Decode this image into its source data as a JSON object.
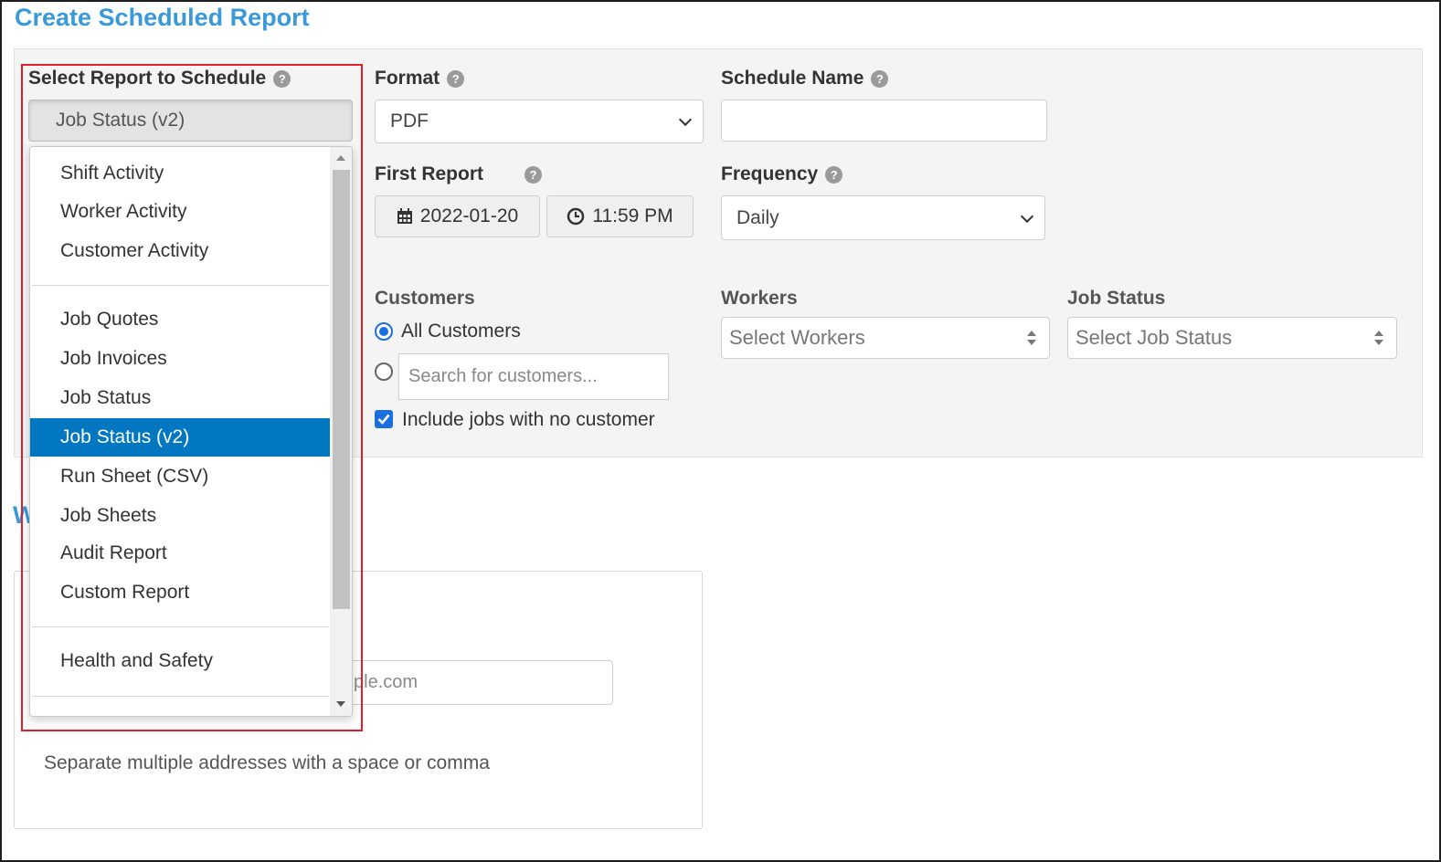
{
  "page": {
    "title": "Create Scheduled Report"
  },
  "report_select": {
    "label": "Select Report to Schedule",
    "selected": "Job Status (v2)",
    "options": [
      "Shift Activity",
      "Worker Activity",
      "Customer Activity",
      "Job Quotes",
      "Job Invoices",
      "Job Status",
      "Job Status (v2)",
      "Run Sheet (CSV)",
      "Job Sheets",
      "Audit Report",
      "Custom Report",
      "Health and Safety"
    ]
  },
  "format": {
    "label": "Format",
    "value": "PDF"
  },
  "schedule_name": {
    "label": "Schedule Name",
    "value": ""
  },
  "first_report": {
    "label": "First Report",
    "date": "2022-01-20",
    "time": "11:59 PM"
  },
  "frequency": {
    "label": "Frequency",
    "value": "Daily"
  },
  "customers": {
    "label": "Customers",
    "all_label": "All Customers",
    "search_placeholder": "Search for customers...",
    "include_no_customer_label": "Include jobs with no customer"
  },
  "workers": {
    "label": "Workers",
    "placeholder": "Select Workers"
  },
  "job_status": {
    "label": "Job Status",
    "placeholder": "Select Job Status"
  },
  "email": {
    "partial_heading": "W",
    "partial_placeholder": "ple.com",
    "hint": "Separate multiple addresses with a space or comma"
  },
  "help_glyph": "?",
  "colors": {
    "accent": "#3a9ad9",
    "selected_item": "#0077c0",
    "highlight": "#e3202a",
    "control": "#1a6fe0"
  }
}
